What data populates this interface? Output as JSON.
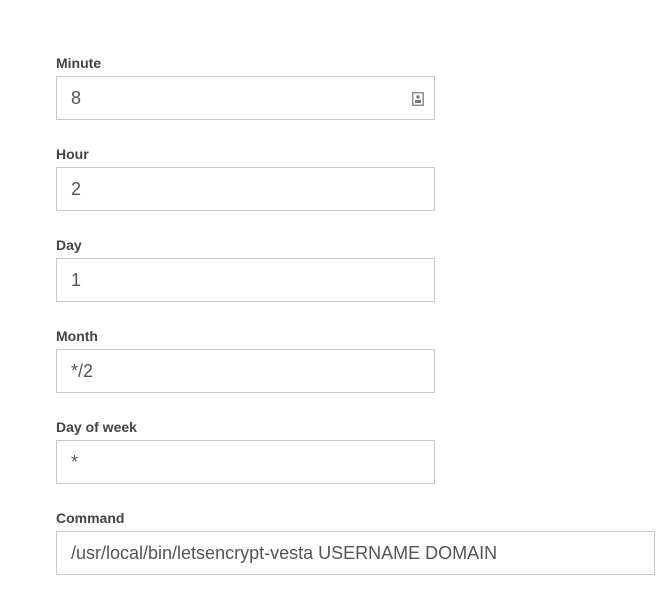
{
  "form": {
    "fields": [
      {
        "label": "Minute",
        "value": "8",
        "icon": "contact-card-icon"
      },
      {
        "label": "Hour",
        "value": "2"
      },
      {
        "label": "Day",
        "value": "1"
      },
      {
        "label": "Month",
        "value": "*/2"
      },
      {
        "label": "Day of week",
        "value": "*"
      },
      {
        "label": "Command",
        "value": "/usr/local/bin/letsencrypt-vesta USERNAME DOMAIN"
      }
    ]
  }
}
